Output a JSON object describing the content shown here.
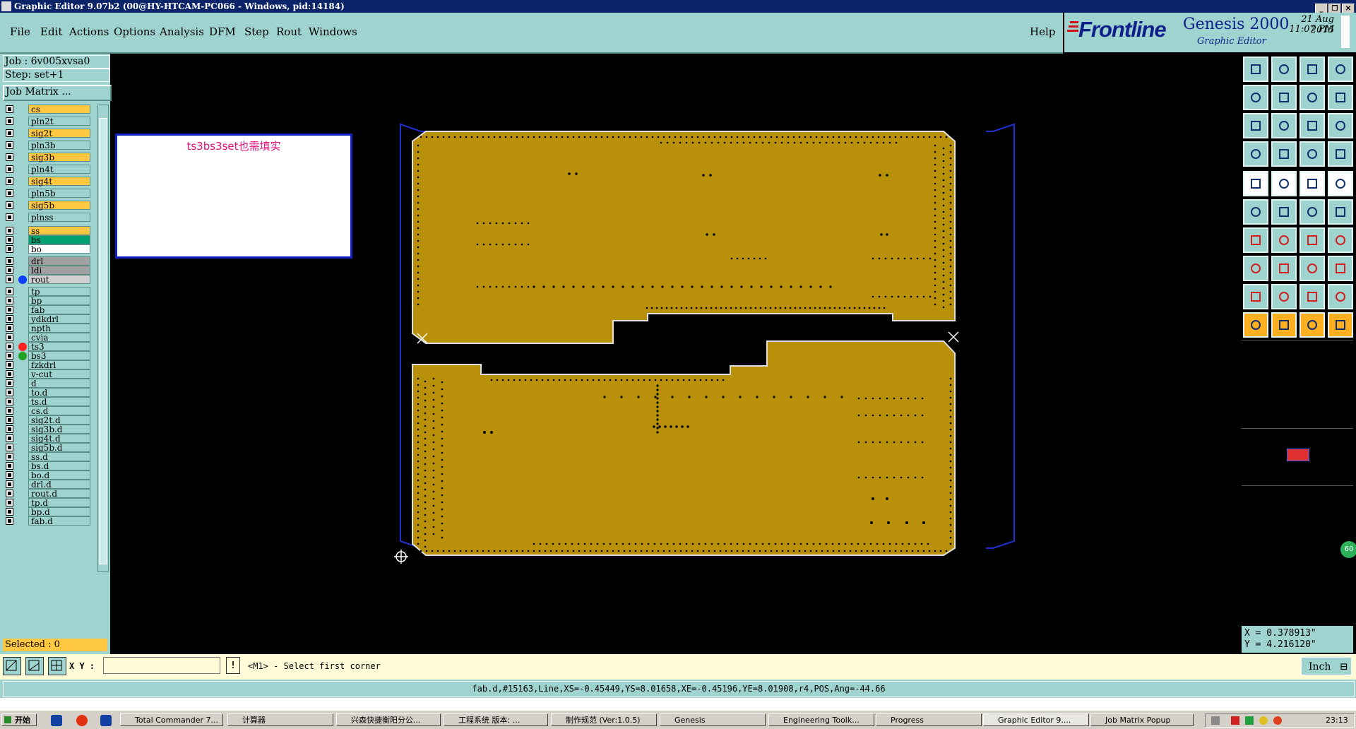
{
  "window": {
    "title": "Graphic Editor 9.07b2 (00@HY-HTCAM-PC066 - Windows, pid:14184)",
    "controls": [
      "_",
      "❐",
      "✕"
    ]
  },
  "menu": {
    "items": [
      "File",
      "Edit",
      "Actions",
      "Options",
      "Analysis",
      "DFM",
      "Step",
      "Rout",
      "Windows"
    ],
    "help": "Help"
  },
  "brand": {
    "logo": "Frontline",
    "product": "Genesis 2000",
    "subtitle": "Graphic Editor",
    "date": "21 Aug 2015",
    "time": "11:07 PM"
  },
  "job": {
    "job_label": "Job : 6v005xvsa0",
    "step_label": "Step: set+1",
    "matrix_button": "Job Matrix ..."
  },
  "layers": [
    {
      "name": "cs",
      "color": "#ffc840",
      "dot": ""
    },
    {
      "name": "pln2t",
      "color": "#9ed3cf",
      "dot": ""
    },
    {
      "name": "sig2t",
      "color": "#ffc840",
      "dot": ""
    },
    {
      "name": "pln3b",
      "color": "#9ed3cf",
      "dot": ""
    },
    {
      "name": "sig3b",
      "color": "#ffc840",
      "dot": ""
    },
    {
      "name": "pln4t",
      "color": "#9ed3cf",
      "dot": ""
    },
    {
      "name": "sig4t",
      "color": "#ffc840",
      "dot": ""
    },
    {
      "name": "pln5b",
      "color": "#9ed3cf",
      "dot": ""
    },
    {
      "name": "sig5b",
      "color": "#ffc840",
      "dot": ""
    },
    {
      "name": "plnss",
      "color": "#9ed3cf",
      "dot": ""
    },
    {
      "name": "ss",
      "color": "#ffc840",
      "dot": ""
    },
    {
      "name": "bs",
      "color": "#00a070",
      "dot": ""
    },
    {
      "name": "bo",
      "color": "#ffffff",
      "dot": ""
    },
    {
      "name": "drl",
      "color": "#a0a0a0",
      "dot": ""
    },
    {
      "name": "ldi",
      "color": "#a0a0a0",
      "dot": ""
    },
    {
      "name": "rout",
      "color": "#d0d0d0",
      "dot": "#1040ff"
    },
    {
      "name": "tp",
      "color": "#9ed3cf",
      "dot": ""
    },
    {
      "name": "bp",
      "color": "#9ed3cf",
      "dot": ""
    },
    {
      "name": "fab",
      "color": "#9ed3cf",
      "dot": ""
    },
    {
      "name": "ydkdrl",
      "color": "#9ed3cf",
      "dot": ""
    },
    {
      "name": "npth",
      "color": "#9ed3cf",
      "dot": ""
    },
    {
      "name": "cvia",
      "color": "#9ed3cf",
      "dot": ""
    },
    {
      "name": "ts3",
      "color": "#9ed3cf",
      "dot": "#ff2020"
    },
    {
      "name": "bs3",
      "color": "#9ed3cf",
      "dot": "#20a020"
    },
    {
      "name": "fzkdrl",
      "color": "#9ed3cf",
      "dot": ""
    },
    {
      "name": "v-cut",
      "color": "#9ed3cf",
      "dot": ""
    },
    {
      "name": "d",
      "color": "#9ed3cf",
      "dot": ""
    },
    {
      "name": "to.d",
      "color": "#9ed3cf",
      "dot": ""
    },
    {
      "name": "ts.d",
      "color": "#9ed3cf",
      "dot": ""
    },
    {
      "name": "cs.d",
      "color": "#9ed3cf",
      "dot": ""
    },
    {
      "name": "sig2t.d",
      "color": "#9ed3cf",
      "dot": ""
    },
    {
      "name": "sig3b.d",
      "color": "#9ed3cf",
      "dot": ""
    },
    {
      "name": "sig4t.d",
      "color": "#9ed3cf",
      "dot": ""
    },
    {
      "name": "sig5b.d",
      "color": "#9ed3cf",
      "dot": ""
    },
    {
      "name": "ss.d",
      "color": "#9ed3cf",
      "dot": ""
    },
    {
      "name": "bs.d",
      "color": "#9ed3cf",
      "dot": ""
    },
    {
      "name": "bo.d",
      "color": "#9ed3cf",
      "dot": ""
    },
    {
      "name": "drl.d",
      "color": "#9ed3cf",
      "dot": ""
    },
    {
      "name": "rout.d",
      "color": "#9ed3cf",
      "dot": ""
    },
    {
      "name": "tp.d",
      "color": "#9ed3cf",
      "dot": ""
    },
    {
      "name": "bp.d",
      "color": "#9ed3cf",
      "dot": ""
    },
    {
      "name": "fab.d",
      "color": "#9ed3cf",
      "dot": ""
    }
  ],
  "selected": "Selected : 0",
  "note": "ts3bs3set也需填实",
  "coords": {
    "x": "X = 0.378913\"",
    "y": "Y = 4.216120\""
  },
  "command": {
    "xy_label": "X Y :",
    "xy_value": "",
    "prompt": "<M1> - Select first corner",
    "units": "Inch"
  },
  "status": "fab.d,#15163,Line,XS=-0.45449,YS=8.01658,XE=-0.45196,YE=8.01908,r4,POS,Ang=-44.66",
  "zoom_badge": "60",
  "taskbar": {
    "start": "开始",
    "tasks": [
      "Total Commander 7...",
      "计算器",
      "兴森快捷衡阳分公...",
      "工程系统   版本: ...",
      "制作规范 (Ver:1.0.5)",
      "Genesis",
      "Engineering Toolk...",
      "Progress",
      "Graphic Editor 9....",
      "Job Matrix Popup"
    ],
    "clock": "23:13"
  },
  "colors": {
    "panel": "#9ed3cf",
    "board": "#b8900a",
    "board_edge": "#e0e0e0",
    "profile": "#2030d0",
    "layer_highlight": "#ffc840"
  }
}
